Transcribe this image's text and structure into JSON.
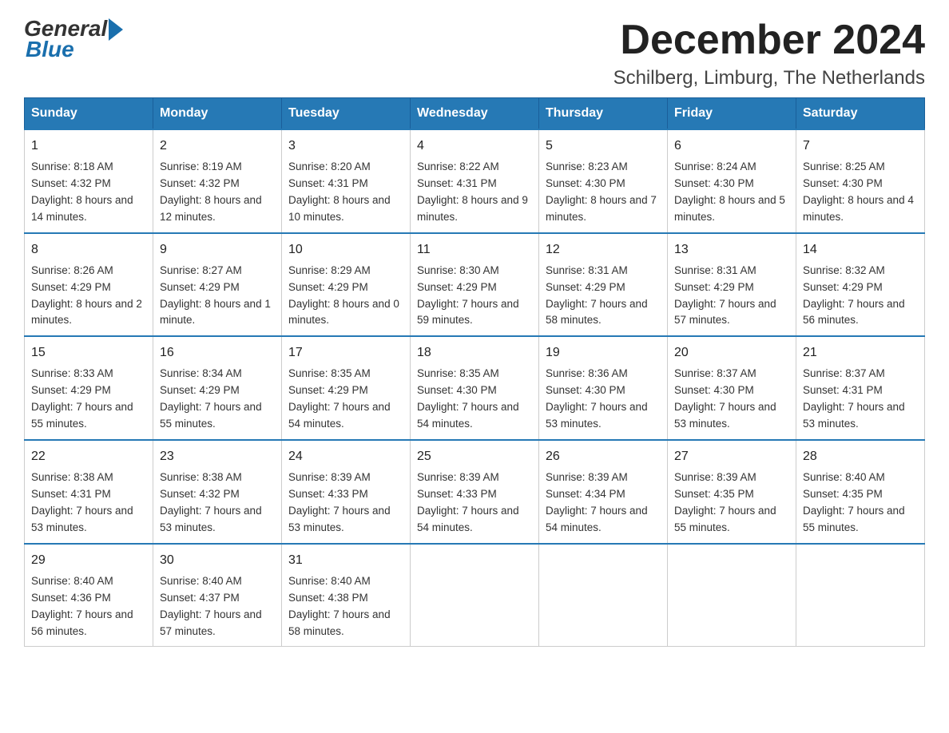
{
  "logo": {
    "general": "General",
    "blue": "Blue"
  },
  "header": {
    "month_year": "December 2024",
    "location": "Schilberg, Limburg, The Netherlands"
  },
  "weekdays": [
    "Sunday",
    "Monday",
    "Tuesday",
    "Wednesday",
    "Thursday",
    "Friday",
    "Saturday"
  ],
  "weeks": [
    [
      {
        "day": "1",
        "sunrise": "8:18 AM",
        "sunset": "4:32 PM",
        "daylight": "8 hours and 14 minutes."
      },
      {
        "day": "2",
        "sunrise": "8:19 AM",
        "sunset": "4:32 PM",
        "daylight": "8 hours and 12 minutes."
      },
      {
        "day": "3",
        "sunrise": "8:20 AM",
        "sunset": "4:31 PM",
        "daylight": "8 hours and 10 minutes."
      },
      {
        "day": "4",
        "sunrise": "8:22 AM",
        "sunset": "4:31 PM",
        "daylight": "8 hours and 9 minutes."
      },
      {
        "day": "5",
        "sunrise": "8:23 AM",
        "sunset": "4:30 PM",
        "daylight": "8 hours and 7 minutes."
      },
      {
        "day": "6",
        "sunrise": "8:24 AM",
        "sunset": "4:30 PM",
        "daylight": "8 hours and 5 minutes."
      },
      {
        "day": "7",
        "sunrise": "8:25 AM",
        "sunset": "4:30 PM",
        "daylight": "8 hours and 4 minutes."
      }
    ],
    [
      {
        "day": "8",
        "sunrise": "8:26 AM",
        "sunset": "4:29 PM",
        "daylight": "8 hours and 2 minutes."
      },
      {
        "day": "9",
        "sunrise": "8:27 AM",
        "sunset": "4:29 PM",
        "daylight": "8 hours and 1 minute."
      },
      {
        "day": "10",
        "sunrise": "8:29 AM",
        "sunset": "4:29 PM",
        "daylight": "8 hours and 0 minutes."
      },
      {
        "day": "11",
        "sunrise": "8:30 AM",
        "sunset": "4:29 PM",
        "daylight": "7 hours and 59 minutes."
      },
      {
        "day": "12",
        "sunrise": "8:31 AM",
        "sunset": "4:29 PM",
        "daylight": "7 hours and 58 minutes."
      },
      {
        "day": "13",
        "sunrise": "8:31 AM",
        "sunset": "4:29 PM",
        "daylight": "7 hours and 57 minutes."
      },
      {
        "day": "14",
        "sunrise": "8:32 AM",
        "sunset": "4:29 PM",
        "daylight": "7 hours and 56 minutes."
      }
    ],
    [
      {
        "day": "15",
        "sunrise": "8:33 AM",
        "sunset": "4:29 PM",
        "daylight": "7 hours and 55 minutes."
      },
      {
        "day": "16",
        "sunrise": "8:34 AM",
        "sunset": "4:29 PM",
        "daylight": "7 hours and 55 minutes."
      },
      {
        "day": "17",
        "sunrise": "8:35 AM",
        "sunset": "4:29 PM",
        "daylight": "7 hours and 54 minutes."
      },
      {
        "day": "18",
        "sunrise": "8:35 AM",
        "sunset": "4:30 PM",
        "daylight": "7 hours and 54 minutes."
      },
      {
        "day": "19",
        "sunrise": "8:36 AM",
        "sunset": "4:30 PM",
        "daylight": "7 hours and 53 minutes."
      },
      {
        "day": "20",
        "sunrise": "8:37 AM",
        "sunset": "4:30 PM",
        "daylight": "7 hours and 53 minutes."
      },
      {
        "day": "21",
        "sunrise": "8:37 AM",
        "sunset": "4:31 PM",
        "daylight": "7 hours and 53 minutes."
      }
    ],
    [
      {
        "day": "22",
        "sunrise": "8:38 AM",
        "sunset": "4:31 PM",
        "daylight": "7 hours and 53 minutes."
      },
      {
        "day": "23",
        "sunrise": "8:38 AM",
        "sunset": "4:32 PM",
        "daylight": "7 hours and 53 minutes."
      },
      {
        "day": "24",
        "sunrise": "8:39 AM",
        "sunset": "4:33 PM",
        "daylight": "7 hours and 53 minutes."
      },
      {
        "day": "25",
        "sunrise": "8:39 AM",
        "sunset": "4:33 PM",
        "daylight": "7 hours and 54 minutes."
      },
      {
        "day": "26",
        "sunrise": "8:39 AM",
        "sunset": "4:34 PM",
        "daylight": "7 hours and 54 minutes."
      },
      {
        "day": "27",
        "sunrise": "8:39 AM",
        "sunset": "4:35 PM",
        "daylight": "7 hours and 55 minutes."
      },
      {
        "day": "28",
        "sunrise": "8:40 AM",
        "sunset": "4:35 PM",
        "daylight": "7 hours and 55 minutes."
      }
    ],
    [
      {
        "day": "29",
        "sunrise": "8:40 AM",
        "sunset": "4:36 PM",
        "daylight": "7 hours and 56 minutes."
      },
      {
        "day": "30",
        "sunrise": "8:40 AM",
        "sunset": "4:37 PM",
        "daylight": "7 hours and 57 minutes."
      },
      {
        "day": "31",
        "sunrise": "8:40 AM",
        "sunset": "4:38 PM",
        "daylight": "7 hours and 58 minutes."
      },
      null,
      null,
      null,
      null
    ]
  ],
  "labels": {
    "sunrise": "Sunrise:",
    "sunset": "Sunset:",
    "daylight": "Daylight:"
  }
}
